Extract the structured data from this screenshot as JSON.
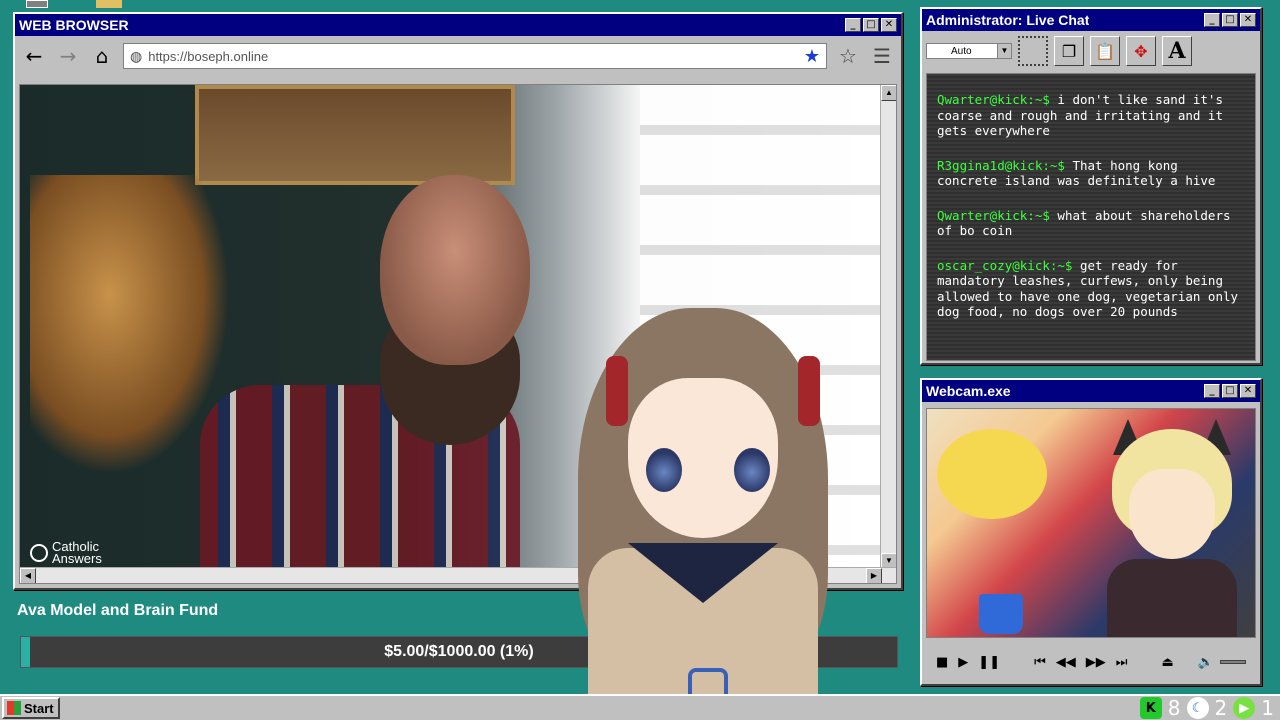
{
  "browser": {
    "title": "WEB BROWSER",
    "url": "https://boseph.online",
    "video_watermark": "Catholic\nAnswers"
  },
  "fund": {
    "title": "Ava Model and Brain Fund",
    "progress_text": "$5.00/$1000.00 (1%)",
    "progress_fraction": 0.01
  },
  "chat": {
    "title": "Administrator: Live Chat",
    "font_select": "Auto",
    "messages": [
      {
        "user": "Qwarter@kick:~$",
        "text": " i don't like sand it's coarse and rough and irritating and it gets everywhere"
      },
      {
        "user": "R3ggina1d@kick:~$",
        "text": " That hong kong concrete island was definitely a hive"
      },
      {
        "user": "Qwarter@kick:~$",
        "text": " what about shareholders of bo coin"
      },
      {
        "user": "oscar_cozy@kick:~$",
        "text": " get ready for mandatory leashes, curfews, only being allowed to have one dog, vegetarian only dog food, no dogs over 20 pounds"
      }
    ],
    "toolbar_icons": [
      "select-icon",
      "copy-icon",
      "paste-icon",
      "move-icon",
      "font-icon"
    ]
  },
  "webcam": {
    "title": "Webcam.exe"
  },
  "taskbar": {
    "start_label": "Start",
    "tray": [
      {
        "icon": "kick-icon",
        "count": "8"
      },
      {
        "icon": "moon-icon",
        "count": "2"
      },
      {
        "icon": "play-icon",
        "count": "1"
      }
    ]
  },
  "colors": {
    "desktop": "#1e8a80",
    "titlebar": "#000080",
    "chat_username": "#3cff3c",
    "fund_fill": "#2ab0a4"
  }
}
